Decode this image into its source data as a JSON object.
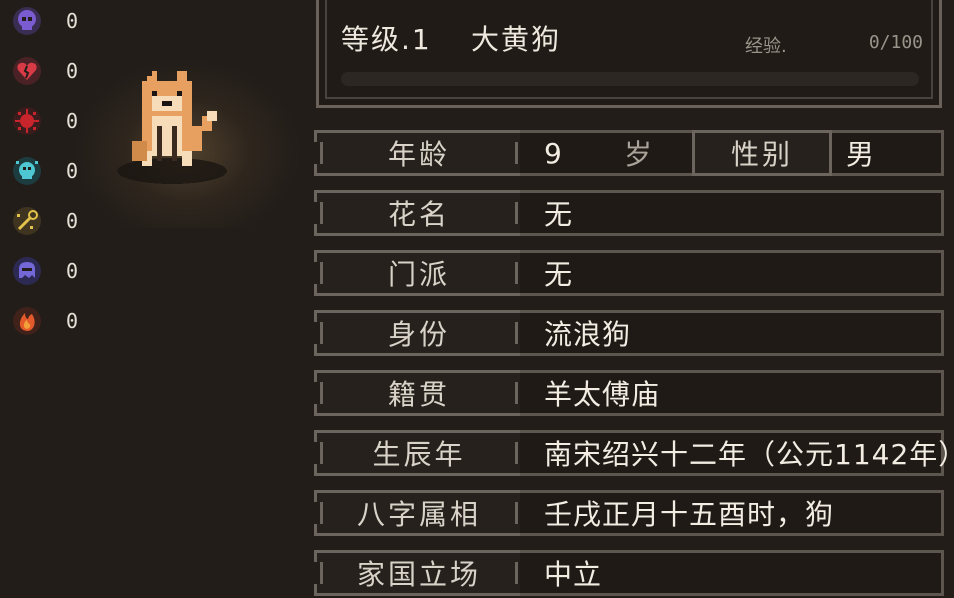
{
  "status_effects": [
    {
      "icon": "purple-skull-icon",
      "color": "#7a5bd0",
      "count": "0"
    },
    {
      "icon": "broken-heart-icon",
      "color": "#d83a46",
      "count": "0"
    },
    {
      "icon": "red-virus-icon",
      "color": "#c8242c",
      "count": "0"
    },
    {
      "icon": "cyan-skull-icon",
      "color": "#4fc7d2",
      "count": "0"
    },
    {
      "icon": "yellow-needle-icon",
      "color": "#e2c24a",
      "count": "0"
    },
    {
      "icon": "purple-ghost-icon",
      "color": "#7468d8",
      "count": "0"
    },
    {
      "icon": "fire-icon",
      "color": "#e45a2a",
      "count": "0"
    }
  ],
  "header": {
    "level": "等级.1",
    "name": "大黄狗",
    "exp_label": "经验.",
    "exp_value": "0/100",
    "exp_progress": 0
  },
  "fields": {
    "age": {
      "label": "年龄",
      "value": "9",
      "unit": "岁"
    },
    "gender": {
      "label": "性别",
      "value": "男"
    },
    "nickname": {
      "label": "花名",
      "value": "无"
    },
    "sect": {
      "label": "门派",
      "value": "无"
    },
    "identity": {
      "label": "身份",
      "value": "流浪狗"
    },
    "hometown": {
      "label": "籍贯",
      "value": "羊太傅庙"
    },
    "birth_year": {
      "label": "生辰年",
      "value": "南宋绍兴十二年（公元1142年）"
    },
    "bazi": {
      "label": "八字属相",
      "value": "壬戌正月十五酉时，狗"
    },
    "allegiance": {
      "label": "家国立场",
      "value": "中立"
    }
  }
}
